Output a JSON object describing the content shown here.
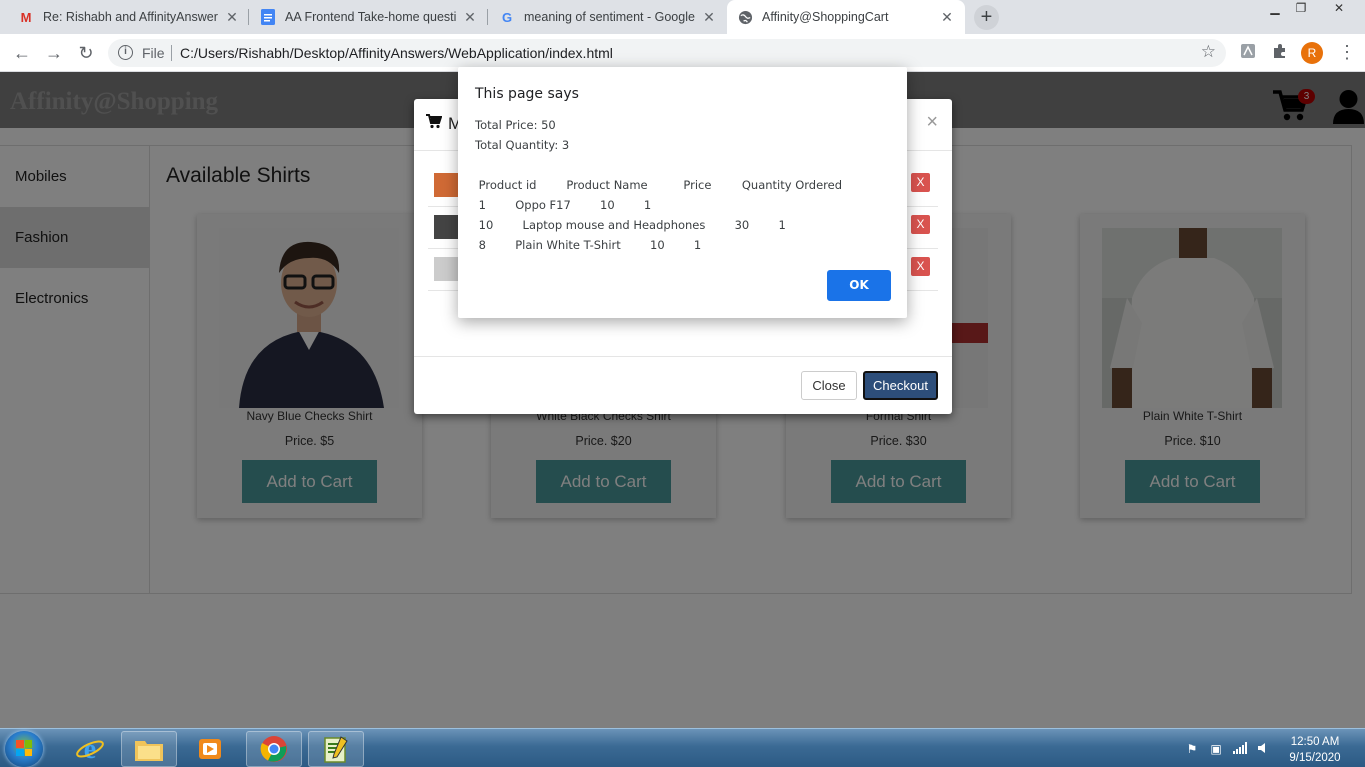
{
  "browser": {
    "tabs": [
      {
        "title": "Re: Rishabh and AffinityAnswers",
        "icon": "gmail-icon",
        "active": false
      },
      {
        "title": "AA Frontend Take-home questio",
        "icon": "google-docs-icon",
        "active": false
      },
      {
        "title": "meaning of sentiment - Google S",
        "icon": "google-icon",
        "active": false
      },
      {
        "title": "Affinity@ShoppingCart",
        "icon": "globe-icon",
        "active": true
      }
    ],
    "address": {
      "scheme_label": "File",
      "url": "C:/Users/Rishabh/Desktop/AffinityAnswers/WebApplication/index.html"
    },
    "profile_initial": "R"
  },
  "site": {
    "brand": "Affinity@Shopping",
    "cart_count": "3",
    "sidebar": [
      {
        "label": "Mobiles",
        "active": false
      },
      {
        "label": "Fashion",
        "active": true
      },
      {
        "label": "Electronics",
        "active": false
      }
    ],
    "section_title": "Available Shirts",
    "products": [
      {
        "name": "Navy Blue Checks Shirt",
        "price": "Price. $5",
        "button": "Add to Cart"
      },
      {
        "name": "White Black Checks Shirt",
        "price": "Price. $20",
        "button": "Add to Cart"
      },
      {
        "name": "Formal Shirt",
        "price": "Price. $30",
        "button": "Add to Cart"
      },
      {
        "name": "Plain White T-Shirt",
        "price": "Price. $10",
        "button": "Add to Cart"
      }
    ]
  },
  "cart_modal": {
    "title_initial": "M",
    "close_symbol": "×",
    "remove_label": "X",
    "close_button": "Close",
    "checkout_button": "Checkout"
  },
  "alert": {
    "title": "This page says",
    "lines": [
      "Total Price: 50",
      "Total Quantity: 3",
      "",
      " Product id \t Product Name \t Price \t Quantity Ordered",
      " 1        Oppo F17        10        1",
      " 10        Laptop mouse and Headphones        30        1",
      " 8        Plain White T-Shirt        10        1"
    ],
    "ok_label": "OK"
  },
  "taskbar": {
    "time": "12:50 AM",
    "date": "9/15/2020"
  }
}
